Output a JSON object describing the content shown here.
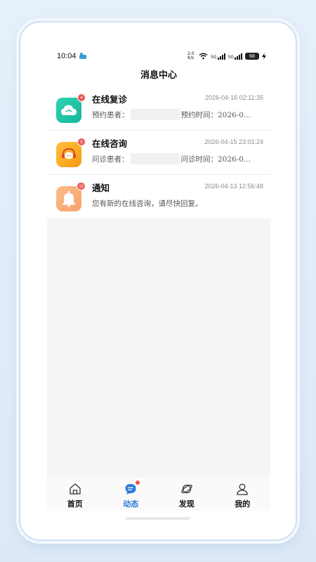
{
  "status_bar": {
    "time": "10:04",
    "net_speed": "2.0 K/s",
    "signal1_label": "5G",
    "signal2_label": "5G",
    "battery": "68"
  },
  "header": {
    "title": "消息中心"
  },
  "messages": [
    {
      "title": "在线复诊",
      "time": "2026-04-16 02:11:35",
      "badge": "4",
      "label_a": "预约患者：",
      "label_b": "预约时间：2026-0...",
      "icon": "cloud-icon",
      "color": "#23c7a5"
    },
    {
      "title": "在线咨询",
      "time": "2026-04-15 23:01:24",
      "badge": "8",
      "label_a": "问诊患者：",
      "label_b": "问诊时间：2026-0...",
      "icon": "chat-bubble-icon",
      "color": "#f7a51a"
    },
    {
      "title": "通知",
      "time": "2026-04-13 12:56:48",
      "badge": "10",
      "text": "您有新的在线咨询，请尽快回复。",
      "icon": "bell-icon",
      "color": "#f9b07a"
    }
  ],
  "tabbar": {
    "items": [
      {
        "label": "首页",
        "icon": "home-icon"
      },
      {
        "label": "动态",
        "icon": "message-icon",
        "active": true
      },
      {
        "label": "发现",
        "icon": "planet-icon"
      },
      {
        "label": "我的",
        "icon": "user-icon"
      }
    ]
  }
}
